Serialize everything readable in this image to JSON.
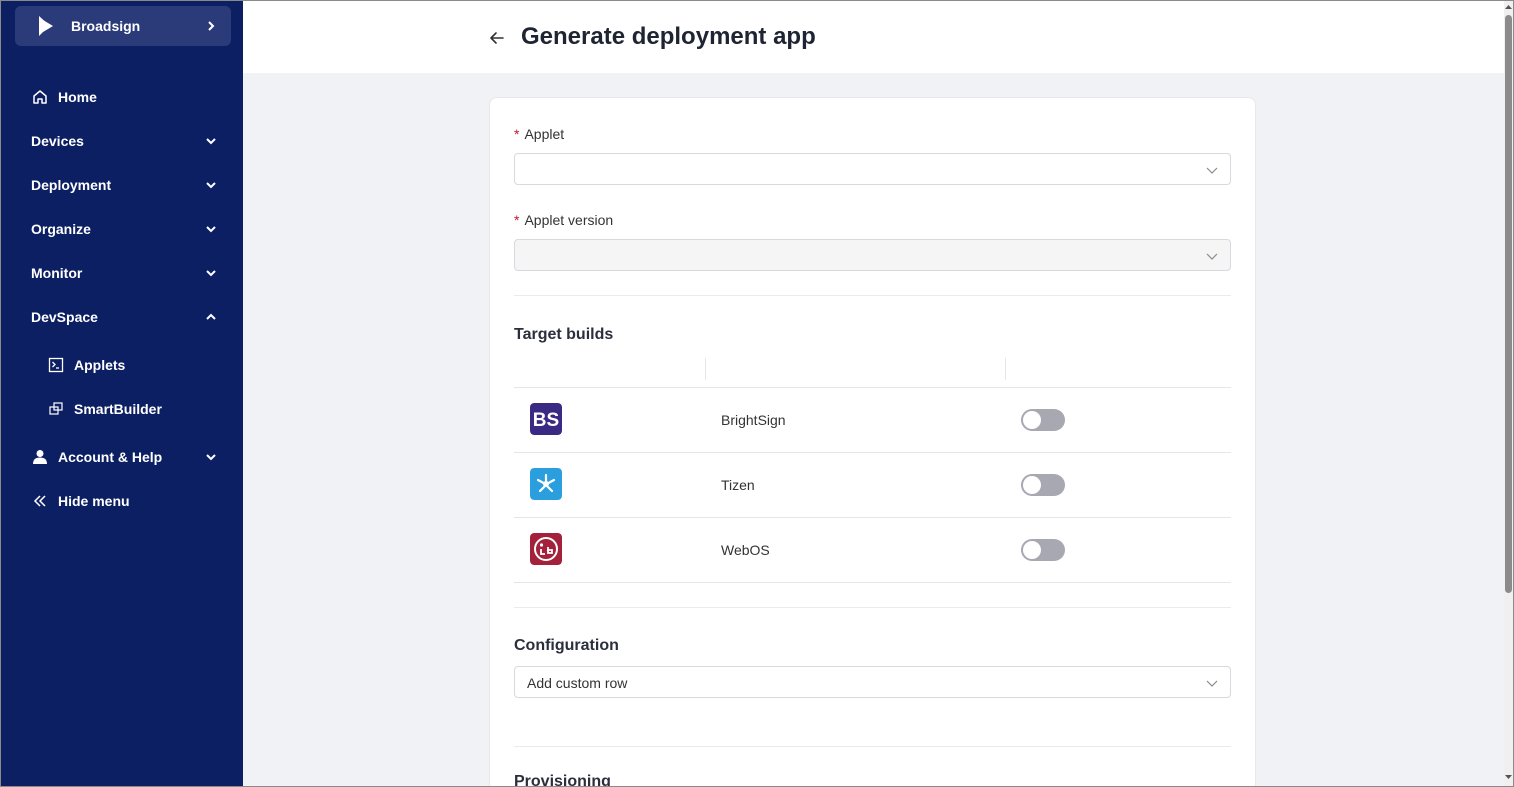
{
  "brand": {
    "name": "Broadsign",
    "accent": "#0d1f63"
  },
  "nav": {
    "home": "Home",
    "devices": "Devices",
    "deployment": "Deployment",
    "organize": "Organize",
    "monitor": "Monitor",
    "devspace": "DevSpace",
    "applets": "Applets",
    "smartbuilder": "SmartBuilder",
    "account": "Account & Help",
    "hide_menu": "Hide menu"
  },
  "page": {
    "title": "Generate deployment app"
  },
  "form": {
    "applet_label": "Applet",
    "applet_version_label": "Applet version",
    "required_mark": "*",
    "target_builds_title": "Target builds",
    "platforms": [
      {
        "name": "BrightSign",
        "icon": "brightsign-icon",
        "enabled": false
      },
      {
        "name": "Tizen",
        "icon": "tizen-icon",
        "enabled": false
      },
      {
        "name": "WebOS",
        "icon": "webos-icon",
        "enabled": false
      }
    ],
    "configuration_title": "Configuration",
    "configuration_value": "Add custom row",
    "provisioning_title": "Provisioning"
  }
}
